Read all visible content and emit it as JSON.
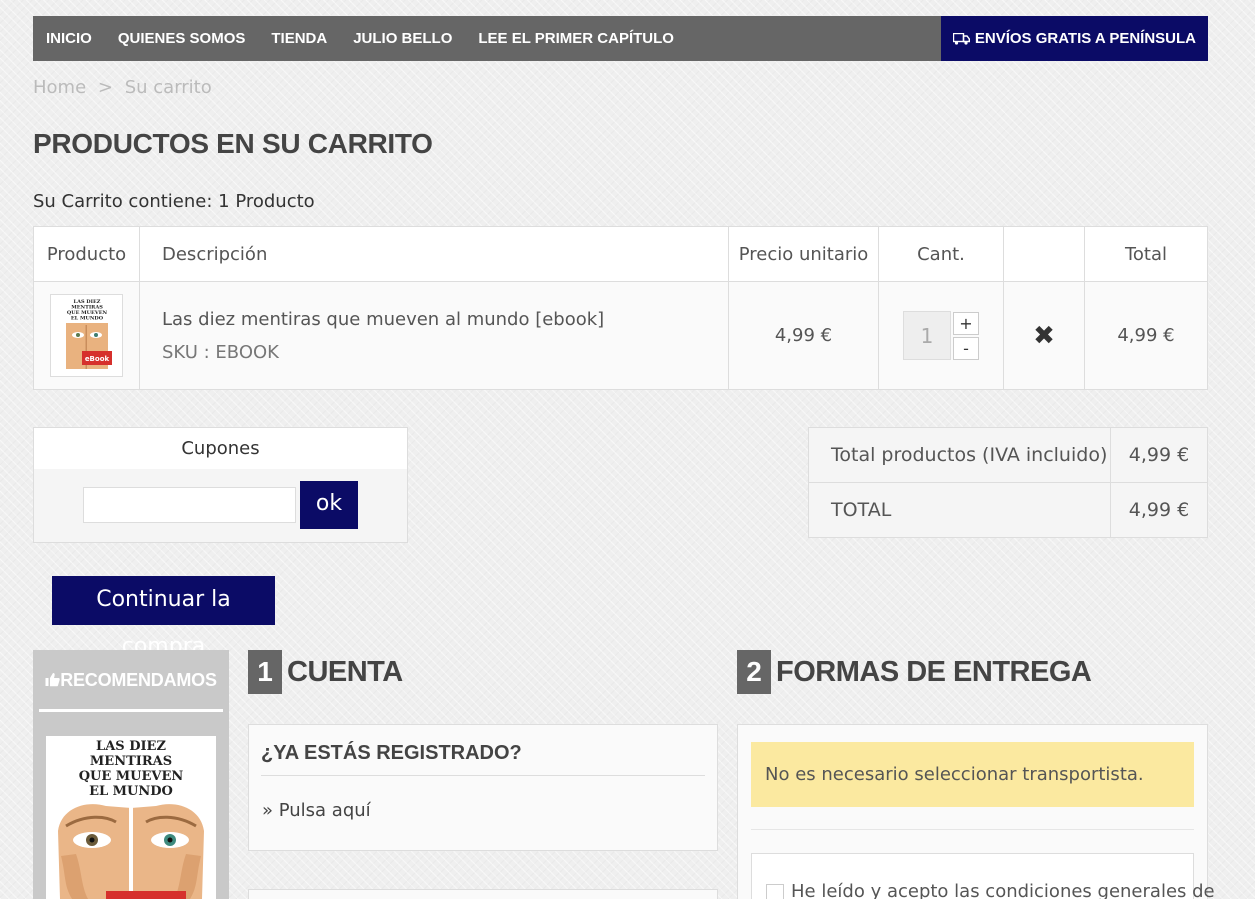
{
  "nav": {
    "items": [
      "INICIO",
      "QUIENES SOMOS",
      "TIENDA",
      "JULIO BELLO",
      "LEE EL PRIMER CAPÍTULO"
    ],
    "shipping": "ENVÍOS GRATIS A PENÍNSULA",
    "shipping_icon": "truck-icon"
  },
  "breadcrumb": {
    "home": "Home",
    "sep": ">",
    "current": "Su carrito"
  },
  "page_title": "PRODUCTOS EN SU CARRITO",
  "cart_count": "Su Carrito contiene: 1 Producto",
  "cart": {
    "headers": {
      "product": "Producto",
      "description": "Descripción",
      "unit_price": "Precio unitario",
      "qty": "Cant.",
      "delete": "",
      "total": "Total"
    },
    "items": [
      {
        "name": "Las diez mentiras que mueven al mundo [ebook]",
        "sku": "SKU : EBOOK",
        "unit_price": "4,99 €",
        "qty": "1",
        "total": "4,99 €",
        "plus": "+",
        "minus": "-",
        "delete_icon": "close-icon"
      }
    ]
  },
  "coupons": {
    "title": "Cupones",
    "input_value": "",
    "ok": "ok"
  },
  "totals": {
    "products_label": "Total productos (IVA incluido)",
    "products_value": "4,99 €",
    "total_label": "TOTAL",
    "total_value": "4,99 €"
  },
  "continue": "Continuar la compra",
  "reco": {
    "title": "RECOMENDAMOS",
    "icon": "thumbs-up-icon",
    "book_title_lines": [
      "LAS DIEZ",
      "MENTIRAS",
      "QUE  MUEVEN",
      "EL MUNDO"
    ]
  },
  "thumb_book": {
    "title_lines": [
      "LAS DIEZ",
      "MENTIRAS",
      "QUE MUEVEN",
      "EL MUNDO"
    ],
    "badge": "eBook"
  },
  "section1": {
    "num": "1",
    "title": "CUENTA",
    "reg_title": "¿YA ESTÁS REGISTRADO?",
    "reg_link": "» Pulsa aquí"
  },
  "section2": {
    "num": "2",
    "title": "FORMAS DE ENTREGA",
    "alert": "No es necesario seleccionar transportista.",
    "terms": "He leído y acepto las condiciones generales de"
  }
}
